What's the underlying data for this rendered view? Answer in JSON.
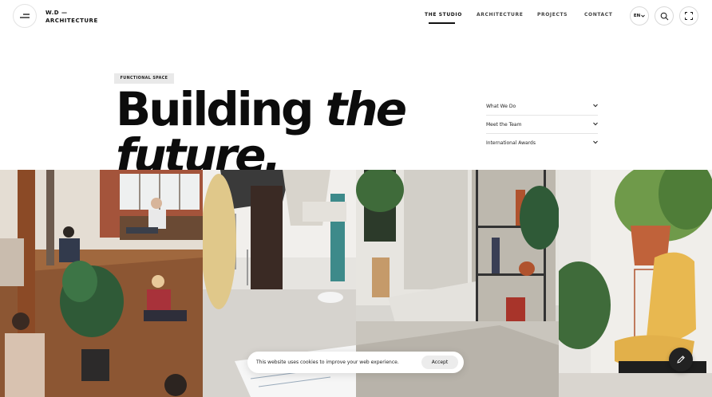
{
  "header": {
    "menu_icon": "menu-lines-icon",
    "logo_line1": "W.D —",
    "logo_line2": "ARCHITECTURE",
    "nav": [
      {
        "label": "THE STUDIO",
        "active": true
      },
      {
        "label": "ARCHITECTURE",
        "active": false
      },
      {
        "label": "PROJECTS",
        "active": false
      },
      {
        "label": "CONTACT",
        "active": false
      }
    ],
    "language": "EN",
    "search_icon": "search-icon",
    "expand_icon": "expand-icon"
  },
  "hero": {
    "tag": "FUNCTIONAL SPACE",
    "headline_word1": "Building",
    "headline_word2": "the",
    "headline_word3": "future."
  },
  "accordion": [
    {
      "label": "What We Do"
    },
    {
      "label": "Meet the Team"
    },
    {
      "label": "International Awards"
    }
  ],
  "cookie": {
    "message": "This website uses cookies to improve your web experience.",
    "accept_label": "Accept"
  },
  "edit_fab_icon": "pencil-icon",
  "colors": {
    "text": "#111111",
    "tag_bg": "#e9e9e9",
    "fab_bg": "#222222"
  }
}
